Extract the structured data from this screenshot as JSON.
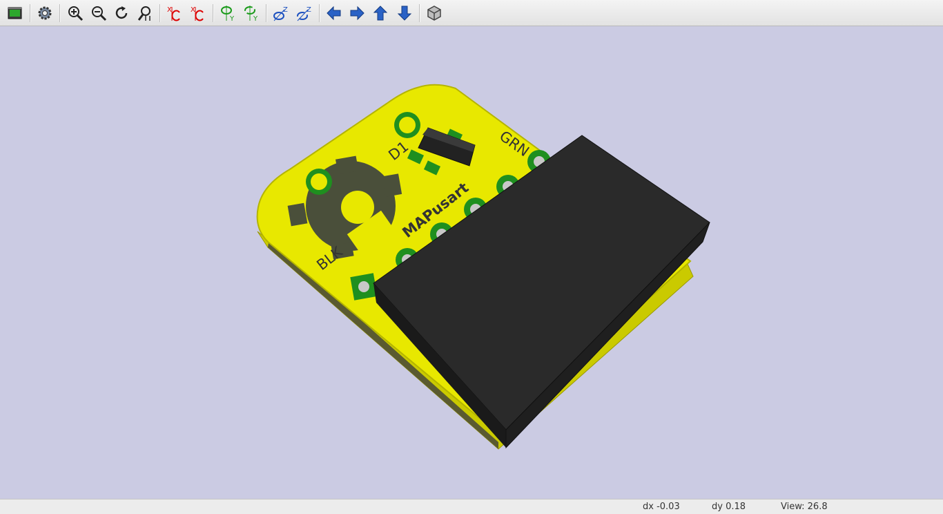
{
  "toolbar": {
    "buttons": [
      {
        "name": "export-image-icon"
      },
      {
        "name": "settings-icon"
      },
      {
        "name": "zoom-in-icon"
      },
      {
        "name": "zoom-out-icon"
      },
      {
        "name": "redraw-icon"
      },
      {
        "name": "zoom-fit-icon"
      },
      {
        "name": "rotate-x-cw-icon"
      },
      {
        "name": "rotate-x-ccw-icon"
      },
      {
        "name": "rotate-y-cw-icon"
      },
      {
        "name": "rotate-y-ccw-icon"
      },
      {
        "name": "rotate-z-cw-icon"
      },
      {
        "name": "rotate-z-ccw-icon"
      },
      {
        "name": "move-left-icon"
      },
      {
        "name": "move-right-icon"
      },
      {
        "name": "move-up-icon"
      },
      {
        "name": "move-down-icon"
      },
      {
        "name": "orthographic-toggle-icon"
      }
    ],
    "axis_labels": {
      "x": "X",
      "y": "Y",
      "z": "Z"
    }
  },
  "board": {
    "labels": {
      "d1": "D1",
      "grn": "GRN",
      "blk": "BLK",
      "name": "MAPusart"
    },
    "colors": {
      "board": "#e8e800",
      "mask": "#1f8f1f",
      "connector": "#202020",
      "background": "#cbcbe3"
    }
  },
  "status": {
    "dx": "dx -0.03",
    "dy": "dy 0.18",
    "view": "View: 26.8"
  }
}
